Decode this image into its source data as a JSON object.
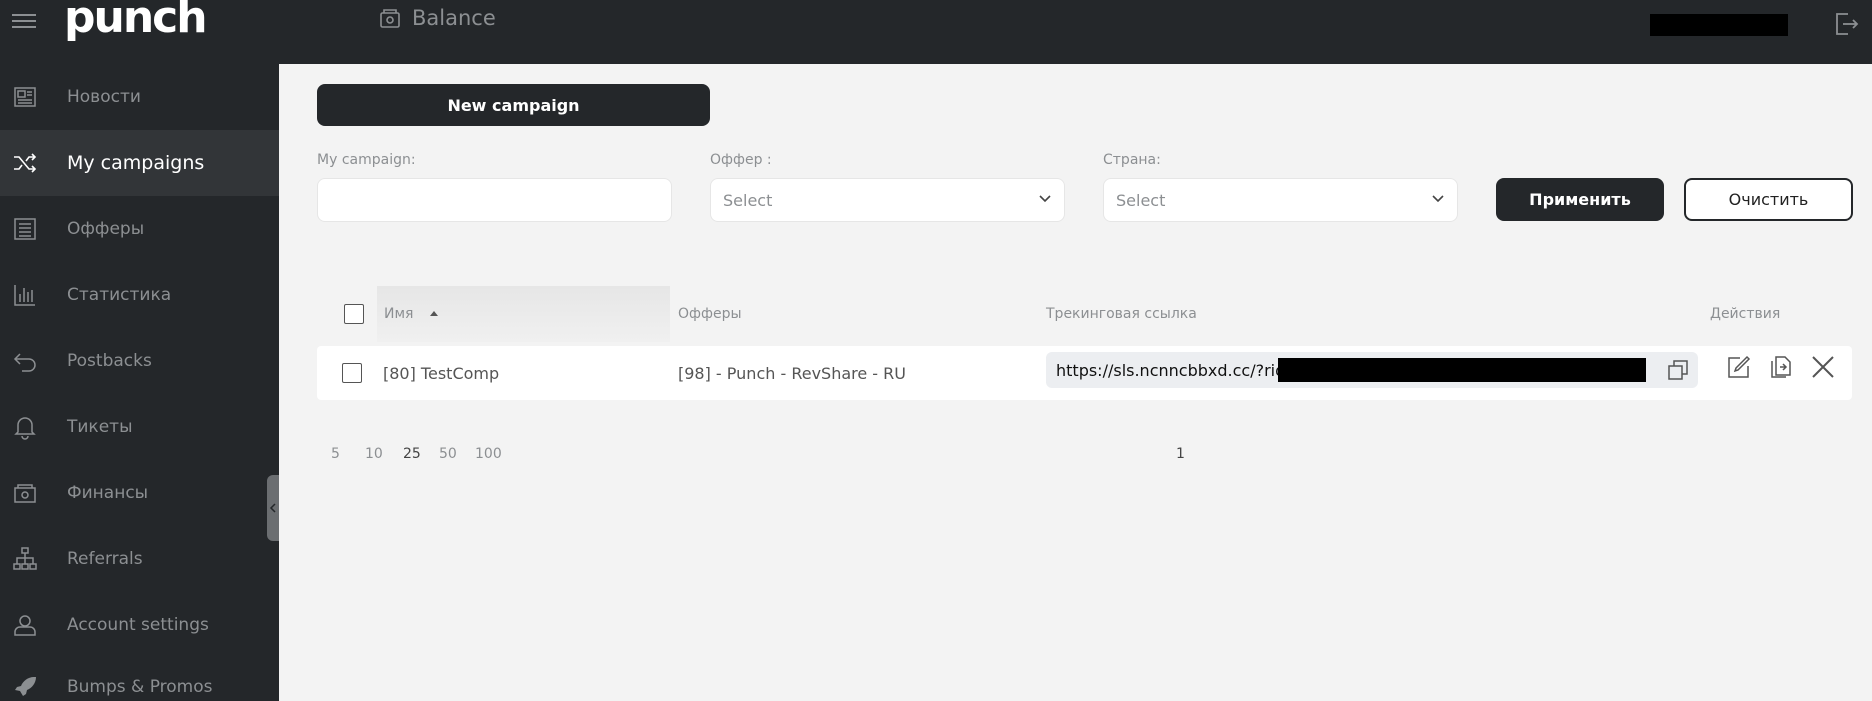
{
  "header": {
    "logo": "punch",
    "balance_label": "Balance"
  },
  "sidebar": {
    "items": [
      {
        "label": "Новости",
        "icon": "newspaper-icon"
      },
      {
        "label": "My campaigns",
        "icon": "shuffle-icon",
        "active": true
      },
      {
        "label": "Офферы",
        "icon": "list-icon"
      },
      {
        "label": "Статистика",
        "icon": "bar-chart-icon"
      },
      {
        "label": "Postbacks",
        "icon": "return-arrow-icon"
      },
      {
        "label": "Тикеты",
        "icon": "bell-icon"
      },
      {
        "label": "Финансы",
        "icon": "safe-icon"
      },
      {
        "label": "Referrals",
        "icon": "hierarchy-icon"
      },
      {
        "label": "Account settings",
        "icon": "user-icon"
      },
      {
        "label": "Bumps & Promos",
        "icon": "rocket-icon"
      }
    ]
  },
  "main": {
    "new_campaign_label": "New campaign",
    "filters": {
      "campaign_label": "My campaign:",
      "campaign_value": "",
      "offer_label": "Оффер :",
      "offer_value": "Select",
      "country_label": "Страна:",
      "country_value": "Select",
      "apply_label": "Применить",
      "clear_label": "Очистить"
    },
    "table": {
      "headers": {
        "name": "Имя",
        "offers": "Офферы",
        "tracking": "Трекинговая ссылка",
        "actions": "Действия"
      },
      "rows": [
        {
          "name": "[80] TestComp",
          "offer": "[98] - Punch - RevShare - RU",
          "tracking_link": "https://sls.ncnncbbxd.cc/?rid="
        }
      ]
    },
    "pagination": {
      "page_sizes": [
        "5",
        "10",
        "25",
        "50",
        "100"
      ],
      "selected_size": "25",
      "current_page": "1"
    }
  },
  "colors": {
    "sidebar_bg": "#24272a",
    "active_item_bg": "#323538",
    "content_bg": "#f3f3f3",
    "primary_button": "#24272a"
  }
}
